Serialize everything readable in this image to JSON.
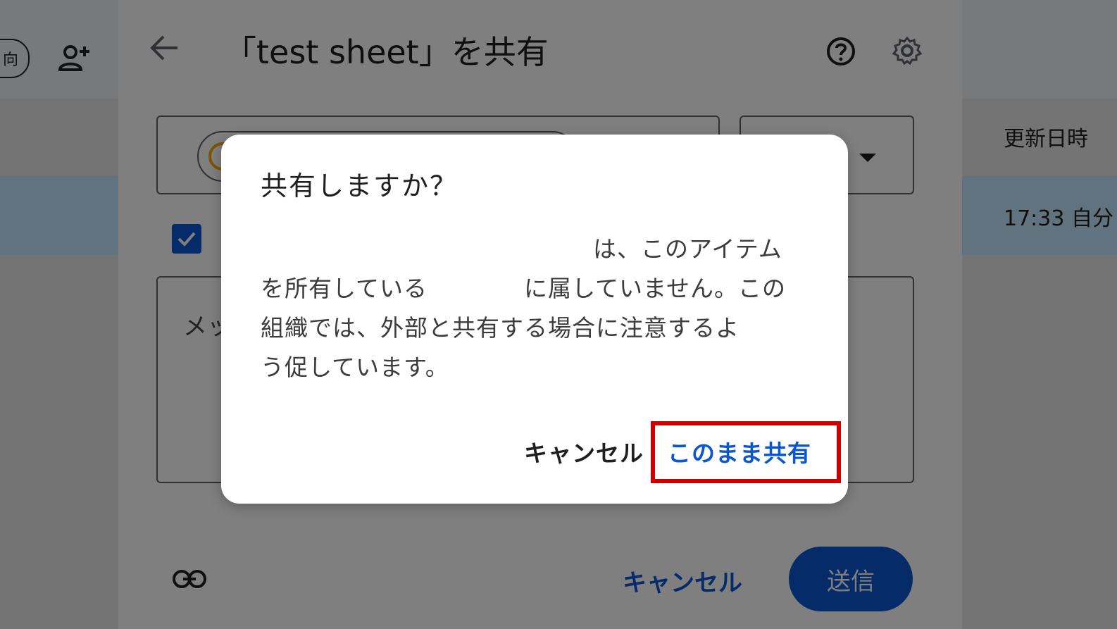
{
  "background": {
    "pill_fragment": "向",
    "column_header": "更新日時",
    "row_modified": "17:33 自分"
  },
  "share_dialog": {
    "title": "「test sheet」を共有",
    "message_placeholder": "メッ",
    "cancel_label": "キャンセル",
    "send_label": "送信",
    "notify_checked": true,
    "accent_color": "#0b57d0"
  },
  "confirm_dialog": {
    "title": "共有しますか？",
    "body_line1": "は、このアイテム",
    "body_line2a": "を所有している",
    "body_line2b": "に属していません。この",
    "body_line3": "組織では、外部と共有する場合に注意するよ",
    "body_line4": "う促しています。",
    "cancel_label": "キャンセル",
    "share_anyway_label": "このまま共有",
    "highlight_color": "#cc0000"
  }
}
